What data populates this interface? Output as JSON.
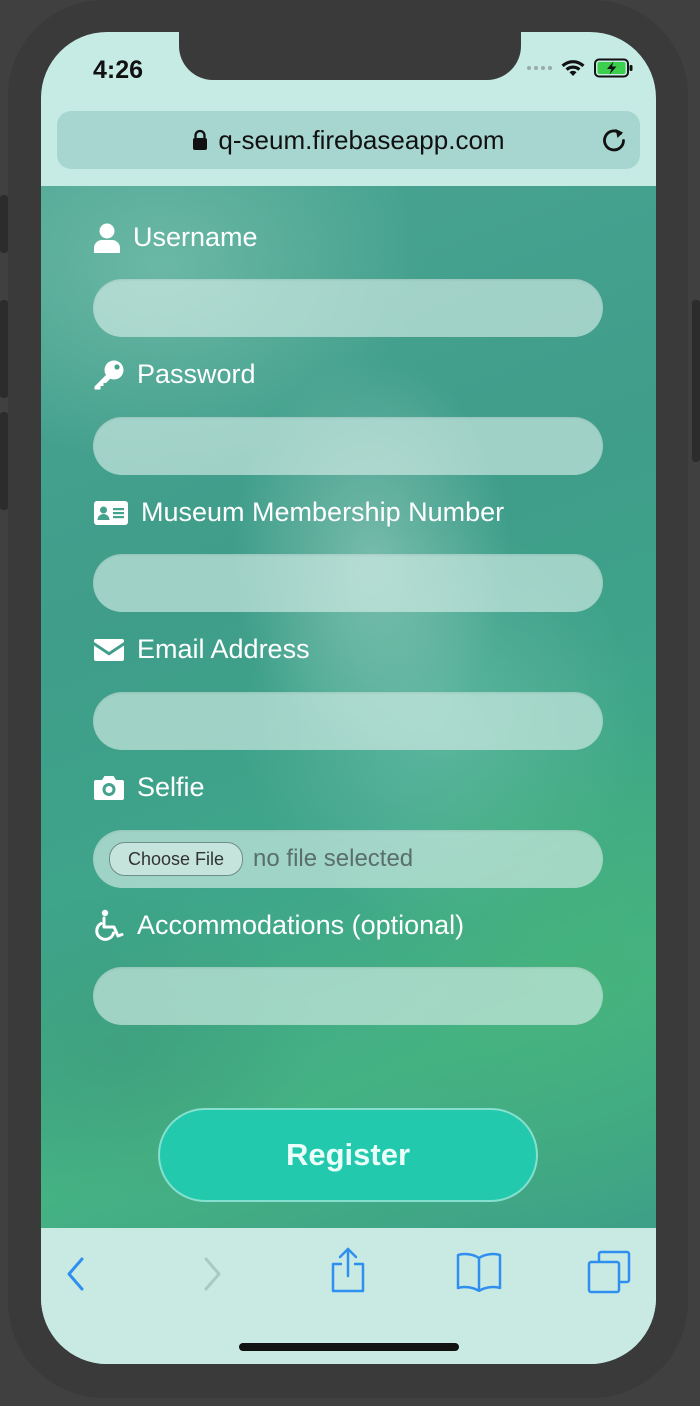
{
  "status_bar": {
    "time": "4:26"
  },
  "browser": {
    "url": "q-seum.firebaseapp.com"
  },
  "form": {
    "username": {
      "label": "Username",
      "value": "",
      "placeholder": ""
    },
    "password": {
      "label": "Password",
      "value": "",
      "placeholder": ""
    },
    "membership": {
      "label": "Museum Membership Number",
      "value": "",
      "placeholder": ""
    },
    "email": {
      "label": "Email Address",
      "value": "",
      "placeholder": ""
    },
    "selfie": {
      "label": "Selfie",
      "button_label": "Choose File",
      "status": "no file selected"
    },
    "accommodations": {
      "label": "Accommodations (optional)",
      "value": "",
      "placeholder": ""
    },
    "submit_label": "Register"
  },
  "colors": {
    "accent": "#22c9ad",
    "browser_chrome": "#c9eae3",
    "toolbar_icon": "#2f8ff0"
  },
  "toolbar_icons": [
    "back-icon",
    "forward-icon",
    "share-icon",
    "bookmarks-icon",
    "tabs-icon"
  ]
}
